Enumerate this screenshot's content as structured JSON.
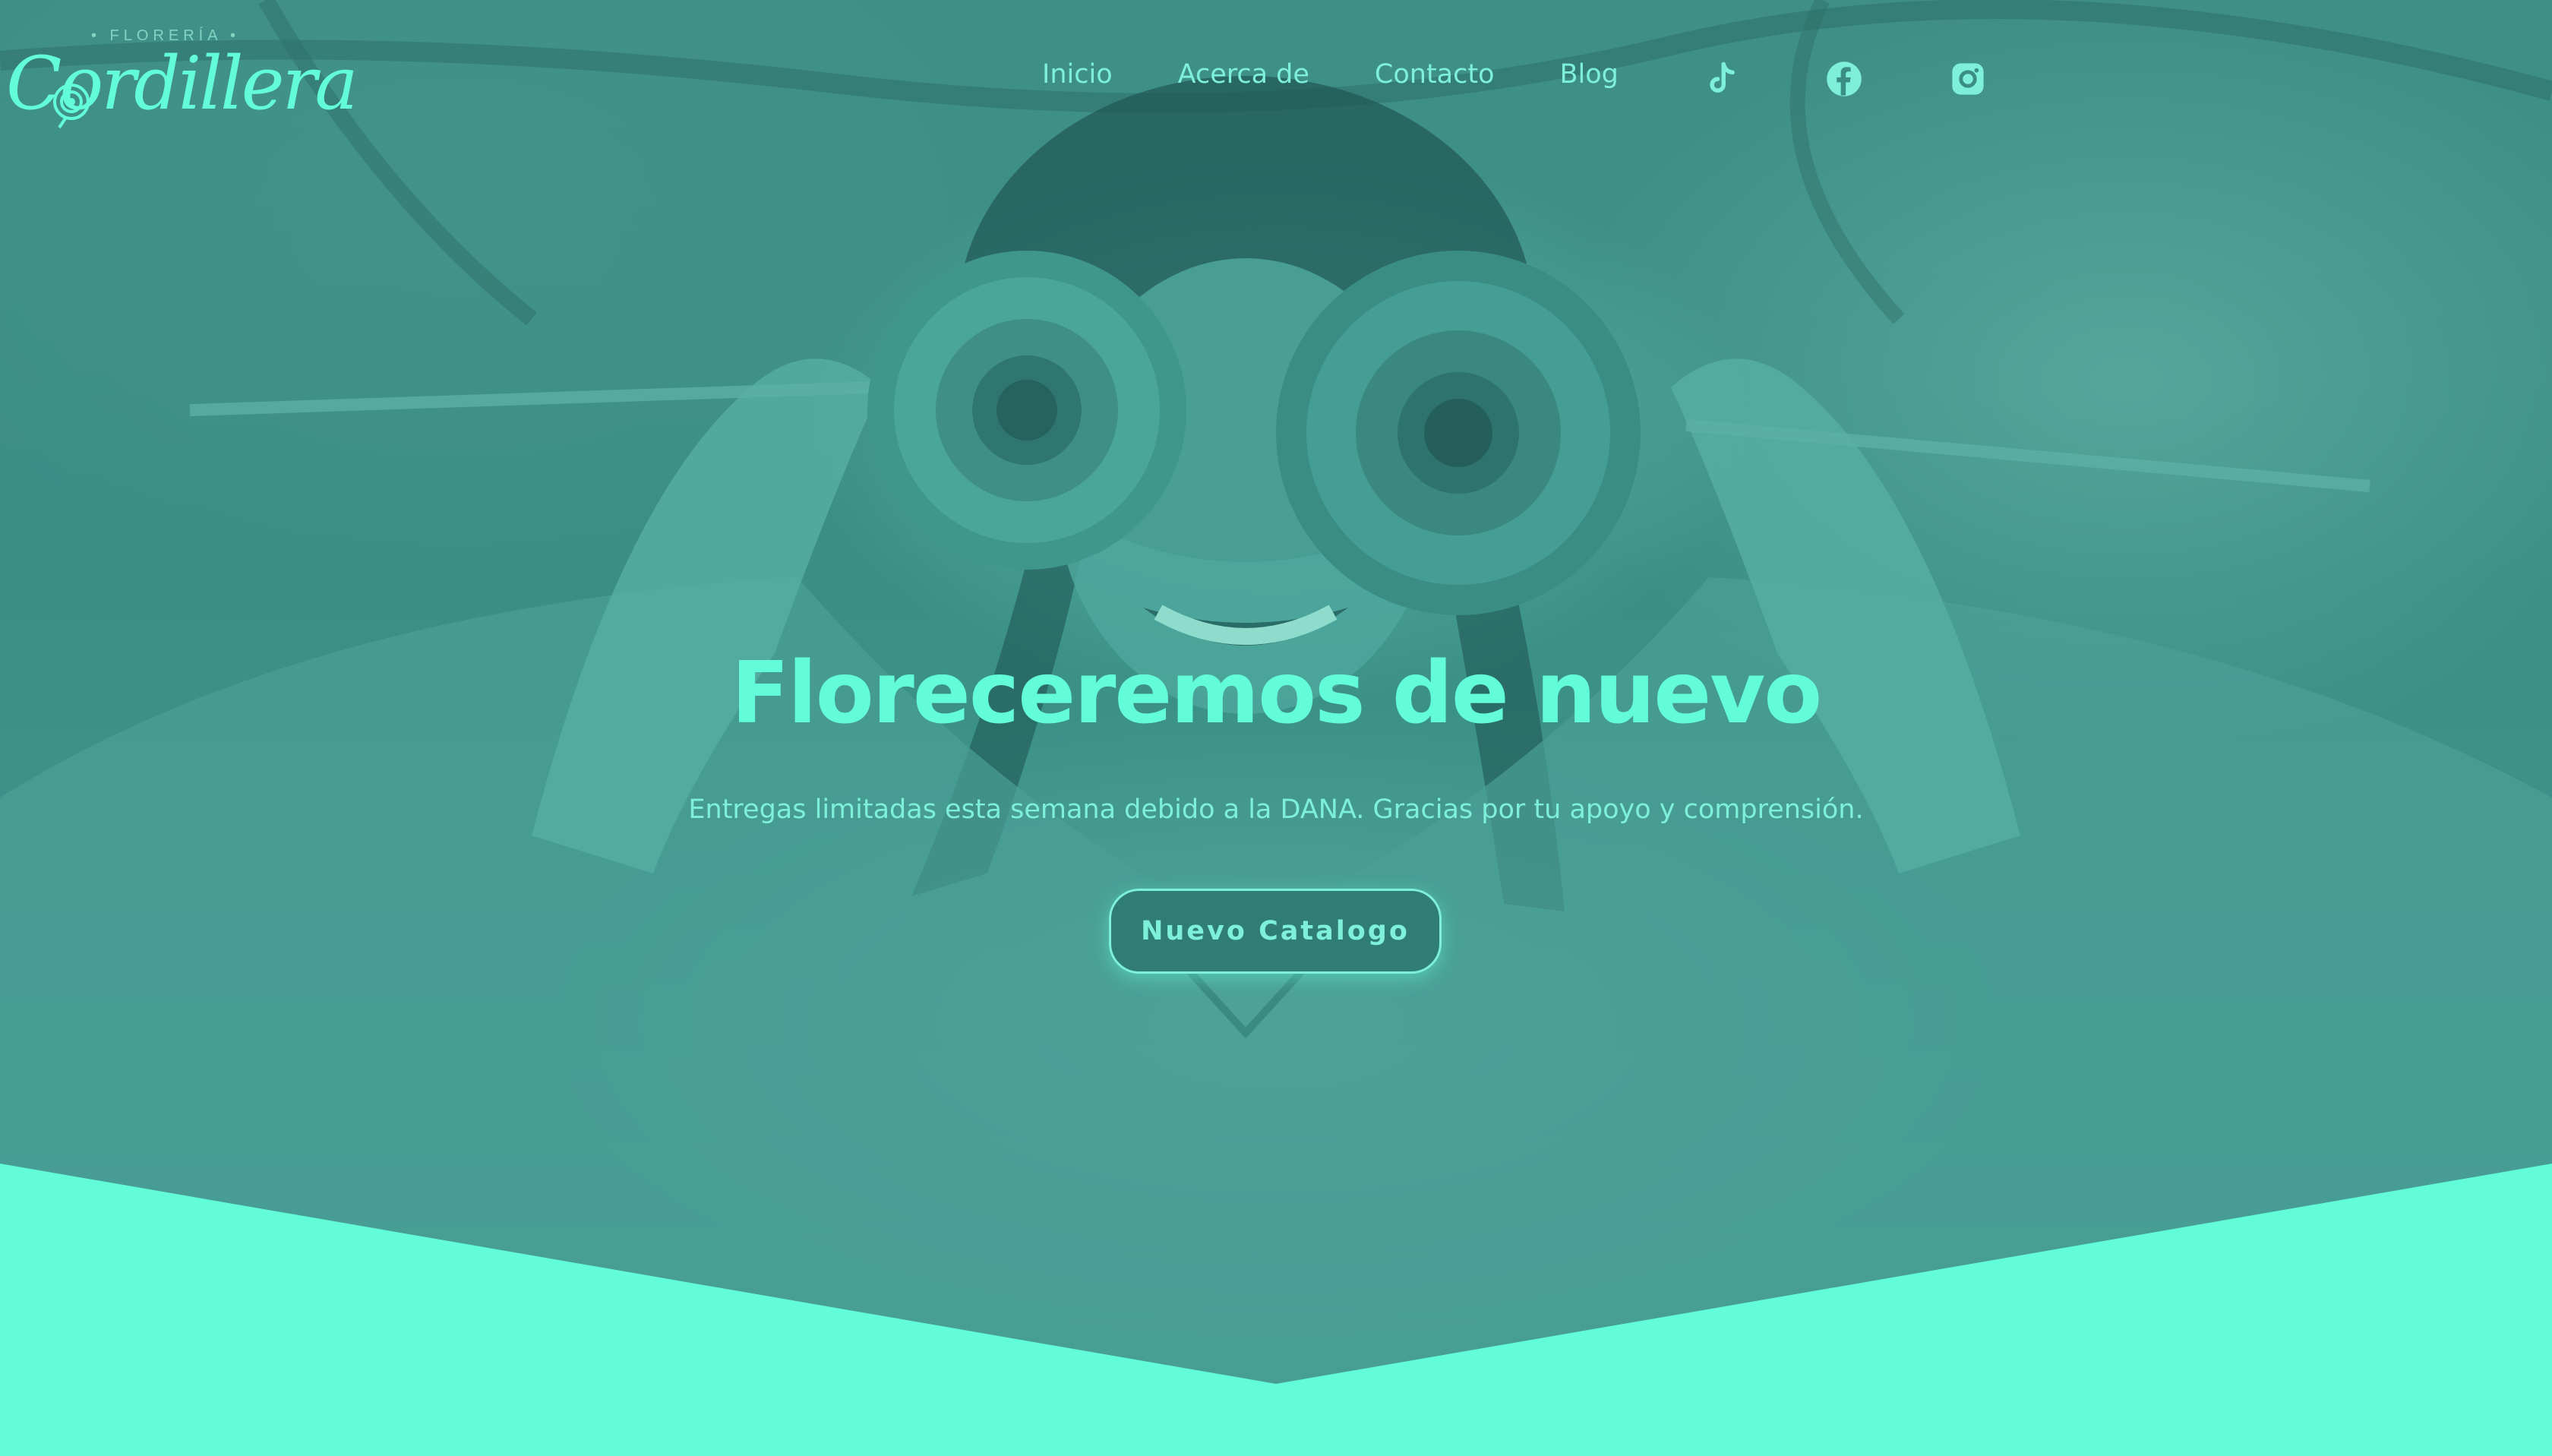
{
  "logo": {
    "kicker": "• FLORERÍA •",
    "name": "Cordillera"
  },
  "nav": {
    "items": [
      {
        "label": "Inicio"
      },
      {
        "label": "Acerca de"
      },
      {
        "label": "Contacto"
      },
      {
        "label": "Blog"
      }
    ],
    "social": [
      {
        "icon": "tiktok-icon"
      },
      {
        "icon": "facebook-icon"
      },
      {
        "icon": "instagram-icon"
      }
    ]
  },
  "hero": {
    "title": "Floreceremos de nuevo",
    "subtitle": "Entregas limitadas esta semana debido a la DANA. Gracias por tu apoyo y comprensión.",
    "cta_label": "Nuevo Catalogo"
  },
  "colors": {
    "accent": "#63fcd9",
    "overlay": "#3a8e86",
    "text_light": "#7ef0d9"
  }
}
